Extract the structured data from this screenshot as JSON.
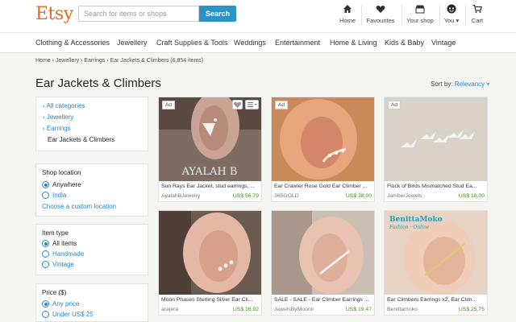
{
  "header": {
    "logo": "Etsy",
    "search_placeholder": "Search for items or shops",
    "search_button": "Search",
    "nav": [
      "Home",
      "Favourites",
      "Your shop",
      "You",
      "Cart"
    ]
  },
  "categories": [
    "Clothing & Accessories",
    "Jewellery",
    "Craft Supplies & Tools",
    "Weddings",
    "Entertainment",
    "Home & Living",
    "Kids & Baby",
    "Vintage"
  ],
  "breadcrumb": "Home › Jewellery › Earrings › Ear Jackets & Climbers (6,854 items)",
  "page_title": "Ear Jackets & Climbers",
  "sort": {
    "label": "Sort by:",
    "value": "Relevancy"
  },
  "category_panel": {
    "links": [
      "All categories",
      "Jewellery",
      "Earrings"
    ],
    "current": "Ear Jackets & Climbers"
  },
  "shop_location": {
    "heading": "Shop location",
    "options": [
      "Anywhere",
      "India"
    ],
    "custom": "Choose a custom location"
  },
  "item_type": {
    "heading": "Item type",
    "options": [
      "All items",
      "Handmade",
      "Vintage"
    ]
  },
  "price": {
    "heading": "Price ($)",
    "options": [
      "Any price",
      "Under US$ 25"
    ]
  },
  "listings": [
    {
      "ad": "Ad",
      "title": "Sun Rays Ear Jacket, stud earrings, ...",
      "shop": "AyalahBJewelry",
      "price": "US$ 56.79",
      "watermark": "AYALAH B"
    },
    {
      "ad": "Ad",
      "title": "Ear Crawler Rose Gold Ear Climber ...",
      "shop": "365GOLD",
      "price": "US$ 38.00"
    },
    {
      "ad": "Ad",
      "title": "Flock of Birds Mismatched Stud Ea...",
      "shop": "JamberJewels",
      "price": "US$ 18.00"
    },
    {
      "ad": "",
      "title": "Moon Phases Sterling Silver Ear Cli...",
      "shop": "arajera",
      "price": "US$ 16.92"
    },
    {
      "ad": "",
      "title": "SALE - SALE - Ear Climber Earrings ...",
      "shop": "JewelsByMoonli",
      "price": "US$ 19.47"
    },
    {
      "ad": "",
      "title": "Ear Climbers Earrings x2, Ear Clim...",
      "shop": "Benittamoko",
      "price": "US$ 25.75",
      "watermark": "BenittaMoko",
      "watermark2": "Fashion · Online"
    }
  ]
}
